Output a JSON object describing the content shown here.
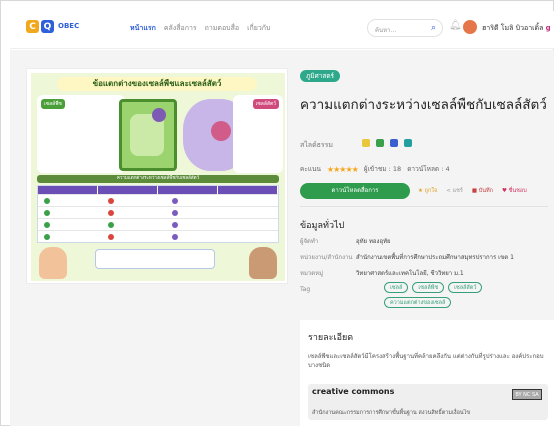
{
  "header": {
    "logo_text": "OBEC",
    "nav": [
      "หน้าแรก",
      "คลังสื่อการ",
      "ถามตอบสื่อ",
      "เกี่ยวกับ"
    ],
    "search_placeholder": "ค้นหา...",
    "user_name": "ฮาริดี โมลิ บิวอาเดิ้ล",
    "user_suffix": "g"
  },
  "media": {
    "category": "ภูมิศาสตร์",
    "title": "ความแตกต่างระหว่างเซลล์พืชกับเซลล์สัตว์",
    "subject": "สไลด์ธรรม",
    "rating_label": "คะแนน",
    "stars": "★★★★★",
    "views": "ผู้เข้าชม : 18",
    "downloads": "ดาวน์โหลด : 4",
    "download_btn": "ดาวน์โหลดสื่อการ",
    "actions": [
      "★ ถูกใจ",
      "< แชร์",
      "■ บันทึก",
      "♥ ชื่นชอบ"
    ]
  },
  "poster": {
    "title": "ข้อแตกต่างของเซลล์พืชและเซลล์สัตว์",
    "plant_label": "เซลล์พืช",
    "animal_label": "เซลล์สัตว์",
    "band_text": "ความแตกต่างระหว่างเซลล์พืชกับเซลล์สัตว์"
  },
  "info": {
    "heading": "ข้อมูลทั่วไป",
    "rows": [
      {
        "k": "ผู้จัดทำ",
        "v": "อุทัย ทองอุทัย"
      },
      {
        "k": "หน่วยงาน/สำนักงาน",
        "v": "สำนักงานเขตพื้นที่การศึกษาประถมศึกษาสมุทรปราการ เขต 1"
      },
      {
        "k": "หมวดหมู่",
        "v": "วิทยาศาสตร์และเทคโนโลยี, ชีววิทยา ม.1"
      },
      {
        "k": "Tag",
        "v": ""
      }
    ],
    "tags": [
      "เซลล์",
      "เซลล์พืช",
      "เซลล์สัตว์",
      "ความแตกต่างของเซลล์"
    ]
  },
  "detail": {
    "heading": "รายละเอียด",
    "text": "เซลล์พืชและเซลล์สัตว์มีโครงสร้างพื้นฐานที่คล้ายคลึงกัน แต่ต่างกันที่รูปร่างและ องค์ประกอบบางชนิด",
    "cc_logo": "creative commons",
    "cc_badge": "BY NC SA",
    "license_text": "สำนักงานคณะกรรมการการศึกษาขั้นพื้นฐาน สงวนสิทธิ์ตามเงื่อนไข"
  }
}
